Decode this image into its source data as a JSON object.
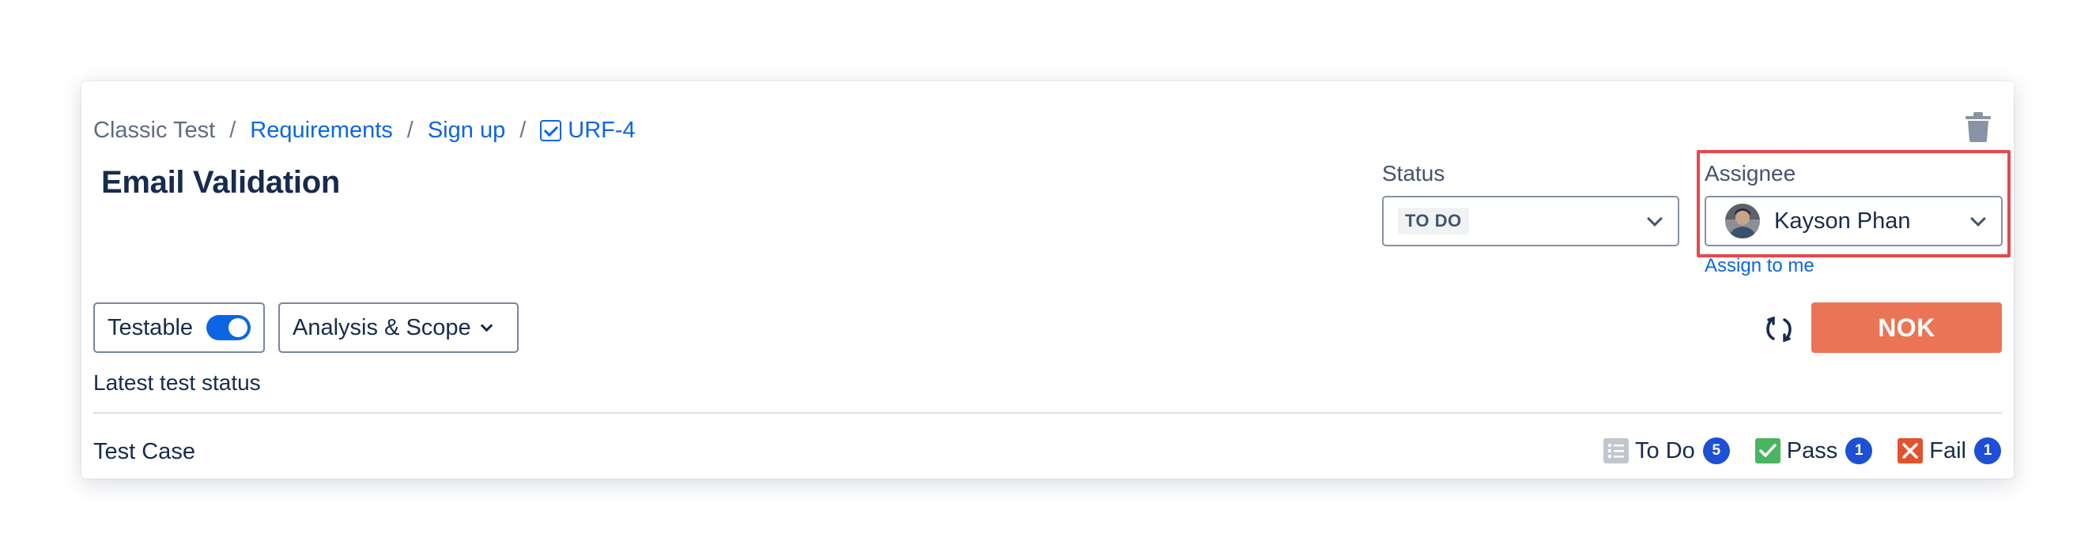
{
  "breadcrumb": {
    "project": "Classic Test",
    "separator": "/",
    "items": [
      "Requirements",
      "Sign up"
    ],
    "issue_key": "URF-4"
  },
  "title": "Email Validation",
  "status": {
    "label": "Status",
    "value": "TO DO"
  },
  "assignee": {
    "label": "Assignee",
    "value": "Kayson Phan",
    "assign_to_me": "Assign to me"
  },
  "controls": {
    "testable_label": "Testable",
    "testable_on": true,
    "analysis_label": "Analysis & Scope",
    "result_button": "NOK"
  },
  "latest_status_label": "Latest test status",
  "test_case": {
    "label": "Test Case",
    "counts": [
      {
        "label": "To Do",
        "count": "5",
        "icon": "todo-list-icon",
        "color": "#c1c7d0"
      },
      {
        "label": "Pass",
        "count": "1",
        "icon": "pass-check-icon",
        "color": "#4bb461"
      },
      {
        "label": "Fail",
        "count": "1",
        "icon": "fail-x-icon",
        "color": "#e2532d"
      }
    ]
  },
  "colors": {
    "accent": "#0c66e4",
    "nok": "#eb7457",
    "highlight": "#e5484d",
    "badge": "#1d4fd7"
  }
}
